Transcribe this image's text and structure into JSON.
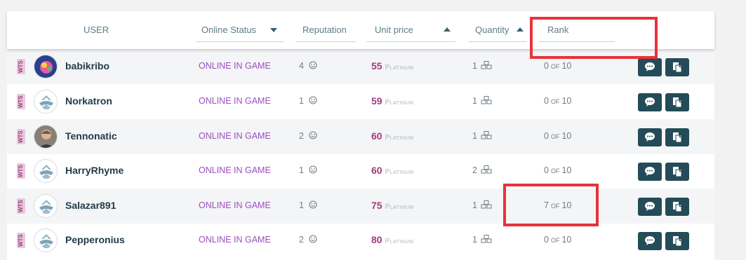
{
  "columns": {
    "user": "USER",
    "online_status": "Online Status",
    "reputation": "Reputation",
    "unit_price": "Unit price",
    "quantity": "Quantity",
    "rank": "Rank"
  },
  "colors": {
    "accent_purple": "#9b4fbf",
    "price_magenta": "#a33a7e",
    "button_teal": "#244b58",
    "highlight_red": "#e8323a"
  },
  "rows": [
    {
      "badge": "WTS",
      "avatar": "custom-avatar-icon",
      "name": "babikribo",
      "status": "ONLINE IN GAME",
      "reputation": "4",
      "price": "55",
      "currency": "Platinum",
      "quantity": "1",
      "rank": "0",
      "rank_of": "OF",
      "rank_max": "10"
    },
    {
      "badge": "WTS",
      "avatar": "warframe-default-avatar-icon",
      "name": "Norkatron",
      "status": "ONLINE IN GAME",
      "reputation": "1",
      "price": "59",
      "currency": "Platinum",
      "quantity": "1",
      "rank": "0",
      "rank_of": "OF",
      "rank_max": "10"
    },
    {
      "badge": "WTS",
      "avatar": "user-photo-avatar",
      "name": "Tennonatic",
      "status": "ONLINE IN GAME",
      "reputation": "2",
      "price": "60",
      "currency": "Platinum",
      "quantity": "1",
      "rank": "0",
      "rank_of": "OF",
      "rank_max": "10"
    },
    {
      "badge": "WTS",
      "avatar": "warframe-default-avatar-icon",
      "name": "HarryRhyme",
      "status": "ONLINE IN GAME",
      "reputation": "1",
      "price": "60",
      "currency": "Platinum",
      "quantity": "2",
      "rank": "0",
      "rank_of": "OF",
      "rank_max": "10"
    },
    {
      "badge": "WTS",
      "avatar": "warframe-default-avatar-icon",
      "name": "Salazar891",
      "status": "ONLINE IN GAME",
      "reputation": "1",
      "price": "75",
      "currency": "Platinum",
      "quantity": "1",
      "rank": "7",
      "rank_of": "OF",
      "rank_max": "10"
    },
    {
      "badge": "WTS",
      "avatar": "warframe-default-avatar-icon",
      "name": "Pepperonius",
      "status": "ONLINE IN GAME",
      "reputation": "2",
      "price": "80",
      "currency": "Platinum",
      "quantity": "1",
      "rank": "0",
      "rank_of": "OF",
      "rank_max": "10"
    }
  ]
}
